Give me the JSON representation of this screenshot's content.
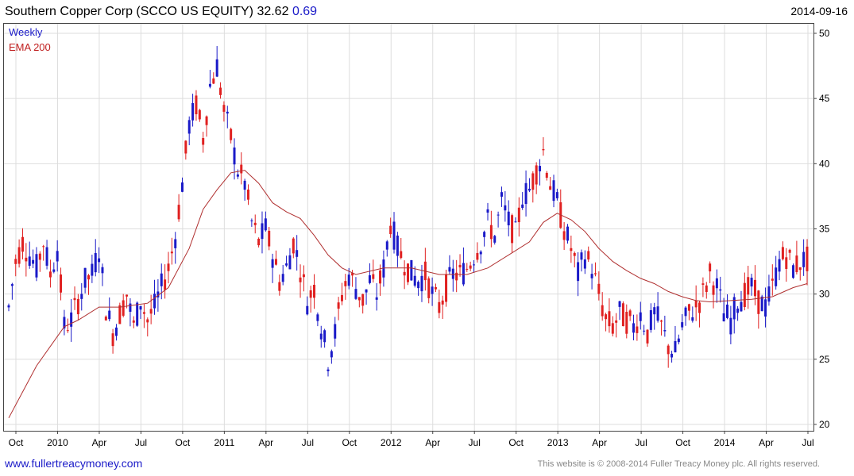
{
  "header": {
    "title_text": "Southern Copper Corp (SCCO US EQUITY) 32.62",
    "change": "0.69",
    "date": "2014-09-16"
  },
  "legend": {
    "weekly": "Weekly",
    "ema": "EMA 200"
  },
  "footer": {
    "site": "www.fullertreacymoney.com",
    "copyright": "This website is © 2008-2014 Fuller Treacy Money plc. All rights reserved."
  },
  "colors": {
    "up": "#1a1ac8",
    "down": "#e02020",
    "ema": "#b03030",
    "grid": "#dddddd"
  },
  "chart_data": {
    "type": "candlestick",
    "interval": "weekly",
    "ylim": [
      20,
      50
    ],
    "yticks": [
      20,
      25,
      30,
      35,
      40,
      45,
      50
    ],
    "xticks": [
      "Oct",
      "2010",
      "Apr",
      "Jul",
      "Oct",
      "2011",
      "Apr",
      "Jul",
      "Oct",
      "2012",
      "Apr",
      "Jul",
      "Oct",
      "2013",
      "Apr",
      "Jul",
      "Oct",
      "2014",
      "Apr",
      "Jul"
    ],
    "close_path": [
      [
        0,
        29.0
      ],
      [
        2,
        32.5
      ],
      [
        4,
        34.0
      ],
      [
        6,
        33.0
      ],
      [
        8,
        32.0
      ],
      [
        10,
        34.0
      ],
      [
        12,
        31.5
      ],
      [
        14,
        33.5
      ],
      [
        16,
        27.5
      ],
      [
        18,
        28.0
      ],
      [
        20,
        29.5
      ],
      [
        22,
        31.0
      ],
      [
        24,
        31.5
      ],
      [
        26,
        33.5
      ],
      [
        28,
        29.0
      ],
      [
        30,
        27.0
      ],
      [
        32,
        28.5
      ],
      [
        34,
        30.0
      ],
      [
        36,
        27.5
      ],
      [
        38,
        29.5
      ],
      [
        40,
        28.0
      ],
      [
        42,
        29.0
      ],
      [
        44,
        30.5
      ],
      [
        46,
        32.0
      ],
      [
        48,
        34.5
      ],
      [
        50,
        38.5
      ],
      [
        52,
        43.0
      ],
      [
        54,
        44.5
      ],
      [
        56,
        42.0
      ],
      [
        58,
        46.0
      ],
      [
        60,
        47.5
      ],
      [
        62,
        44.0
      ],
      [
        64,
        42.0
      ],
      [
        66,
        39.5
      ],
      [
        68,
        38.5
      ],
      [
        70,
        35.5
      ],
      [
        72,
        34.0
      ],
      [
        74,
        35.0
      ],
      [
        76,
        33.0
      ],
      [
        78,
        31.0
      ],
      [
        80,
        32.0
      ],
      [
        82,
        34.0
      ],
      [
        84,
        32.0
      ],
      [
        86,
        29.5
      ],
      [
        88,
        30.5
      ],
      [
        90,
        27.5
      ],
      [
        92,
        25.0
      ],
      [
        94,
        27.0
      ],
      [
        96,
        30.0
      ],
      [
        98,
        31.5
      ],
      [
        100,
        30.5
      ],
      [
        102,
        29.5
      ],
      [
        104,
        31.0
      ],
      [
        106,
        30.0
      ],
      [
        108,
        32.0
      ],
      [
        110,
        35.5
      ],
      [
        112,
        33.5
      ],
      [
        114,
        32.5
      ],
      [
        116,
        31.5
      ],
      [
        118,
        31.0
      ],
      [
        120,
        31.5
      ],
      [
        122,
        30.0
      ],
      [
        124,
        29.0
      ],
      [
        126,
        30.5
      ],
      [
        128,
        31.5
      ],
      [
        130,
        31.5
      ],
      [
        132,
        32.0
      ],
      [
        134,
        33.0
      ],
      [
        136,
        34.0
      ],
      [
        138,
        35.5
      ],
      [
        140,
        34.5
      ],
      [
        142,
        37.0
      ],
      [
        144,
        35.5
      ],
      [
        146,
        34.5
      ],
      [
        148,
        37.5
      ],
      [
        150,
        38.0
      ],
      [
        152,
        39.5
      ],
      [
        154,
        41.0
      ],
      [
        156,
        38.5
      ],
      [
        158,
        37.0
      ],
      [
        160,
        35.0
      ],
      [
        162,
        33.5
      ],
      [
        164,
        31.5
      ],
      [
        166,
        33.0
      ],
      [
        168,
        32.0
      ],
      [
        170,
        30.0
      ],
      [
        172,
        28.0
      ],
      [
        174,
        27.5
      ],
      [
        176,
        28.5
      ],
      [
        178,
        28.0
      ],
      [
        180,
        27.5
      ],
      [
        182,
        28.5
      ],
      [
        184,
        27.0
      ],
      [
        186,
        28.5
      ],
      [
        188,
        27.5
      ],
      [
        190,
        26.0
      ],
      [
        192,
        25.5
      ],
      [
        194,
        27.5
      ],
      [
        196,
        28.5
      ],
      [
        198,
        29.0
      ],
      [
        200,
        30.0
      ],
      [
        202,
        31.5
      ],
      [
        204,
        30.5
      ],
      [
        206,
        28.5
      ],
      [
        208,
        28.0
      ],
      [
        210,
        29.5
      ],
      [
        212,
        30.0
      ],
      [
        214,
        30.5
      ],
      [
        216,
        29.5
      ],
      [
        218,
        29.0
      ],
      [
        220,
        30.5
      ],
      [
        222,
        32.5
      ],
      [
        224,
        33.0
      ],
      [
        226,
        32.0
      ],
      [
        228,
        32.5
      ],
      [
        230,
        32.62
      ]
    ],
    "ema200": [
      [
        0,
        20.5
      ],
      [
        8,
        24.5
      ],
      [
        16,
        27.5
      ],
      [
        20,
        28.0
      ],
      [
        26,
        29.0
      ],
      [
        32,
        29.0
      ],
      [
        40,
        29.3
      ],
      [
        46,
        30.5
      ],
      [
        52,
        33.5
      ],
      [
        56,
        36.5
      ],
      [
        60,
        38.0
      ],
      [
        64,
        39.3
      ],
      [
        68,
        39.5
      ],
      [
        72,
        38.5
      ],
      [
        76,
        37.0
      ],
      [
        80,
        36.3
      ],
      [
        84,
        35.8
      ],
      [
        88,
        34.5
      ],
      [
        92,
        33.0
      ],
      [
        96,
        32.0
      ],
      [
        100,
        31.5
      ],
      [
        108,
        32.0
      ],
      [
        116,
        32.0
      ],
      [
        124,
        31.5
      ],
      [
        132,
        31.5
      ],
      [
        138,
        32.0
      ],
      [
        144,
        33.0
      ],
      [
        150,
        34.0
      ],
      [
        154,
        35.5
      ],
      [
        158,
        36.2
      ],
      [
        162,
        35.7
      ],
      [
        166,
        34.8
      ],
      [
        170,
        33.5
      ],
      [
        174,
        32.5
      ],
      [
        178,
        31.8
      ],
      [
        182,
        31.2
      ],
      [
        186,
        30.8
      ],
      [
        190,
        30.2
      ],
      [
        194,
        29.8
      ],
      [
        198,
        29.5
      ],
      [
        202,
        29.4
      ],
      [
        208,
        29.5
      ],
      [
        214,
        29.6
      ],
      [
        220,
        29.8
      ],
      [
        226,
        30.5
      ],
      [
        230,
        30.8
      ]
    ]
  }
}
